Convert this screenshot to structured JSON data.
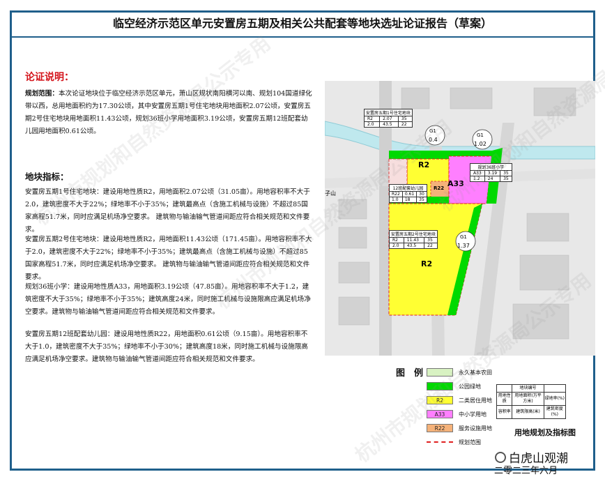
{
  "header": {
    "title": "临空经济示范区单元安置房五期及相关公共配套等地块选址论证报告（草案）"
  },
  "section1": {
    "heading": "论证说明：",
    "lead": "规划范围：",
    "text": "本次论证地块位于临空经济示范区单元，萧山区规状南阳横河以南、规划104国道绿化带以西，总用地面积约为17.30公顷，其中安置房五期1号住宅地块用地面积2.07公顷，安置房五期2号住宅地块用地面积11.43公顷，规划36班小学用地面积3.19公顷，安置房五期12班配套幼儿园用地面积0.61公顷。"
  },
  "section2": {
    "heading": "地块指标：",
    "p1": "安置房五期1号住宅地块：建设用地性质R2，用地面积2.07公顷（31.05亩）。用地容积率不大于2.0，建筑密度不大于22%；绿地率不小于35%；建筑最高点（含施工机械与设施）不超过85国家高程51.7米，同时应满足机场净空要求。 建筑物与输油输气管道间距应符合相关规范和文件要求。",
    "p2": "安置房五期2号住宅地块：建设用地性质R2，用地面积11.43公顷（171.45亩）。用地容积率不大于2.0，建筑密度不大于22%；绿地率不小于35%；建筑最高点（含施工机械与设施）不超过85国家高程51.7米，同时应满足机场净空要求。 建筑物与输油输气管道间距应符合相关规范和文件要求。",
    "p3": "规划36班小学：建设用地性质A33，用地面积3.19公顷（47.85亩）。用地容积率不大于1.2，建筑密度不大于35%；绿地率不小于35%；建筑高度24米，同时施工机械与设施限高应满足机场净空要求。建筑物与输油输气管道间距应符合相关规范和文件要求。",
    "p4": "安置房五期12班配套幼儿园：建设用地性质R22，用地面积0.61公顷（9.15亩）。用地容积率不大于1.0，建筑密度不大于35%；绿地率不小于30%；建筑高度18米，同时施工机械与设施限高应满足机场净空要求。建筑物与输油输气管道间距应符合相关规范和文件要求。"
  },
  "map": {
    "labels": {
      "r2_north": "R2",
      "r2_south": "R2",
      "a33": "A33",
      "r22": "R22",
      "zishan": "子山",
      "g1a": "G1",
      "g1a_val": "0.4",
      "g1b": "G1",
      "g1b_val": "1.02",
      "g1c": "G1",
      "g1c_val": "1.37"
    },
    "table1": {
      "title": "安置房五期1号住宅地块",
      "r1": [
        "R2",
        "2.07",
        "35"
      ],
      "r2": [
        "2.0",
        "43.5",
        "22"
      ]
    },
    "table2": {
      "title": "规划36班小学",
      "r1": [
        "A33",
        "3.19",
        "35"
      ],
      "r2": [
        "1.2",
        "24",
        "35"
      ]
    },
    "table3": {
      "title": "12班配套幼儿园",
      "r1": [
        "R22",
        "0.61",
        "30"
      ],
      "r2": [
        "1.0",
        "18",
        "35"
      ]
    },
    "table4": {
      "title": "安置房五期2号住宅地块",
      "r1": [
        "R2",
        "11.43",
        "35"
      ],
      "r2": [
        "2.0",
        "43.5",
        "22"
      ]
    }
  },
  "legend": {
    "title": "图　例",
    "items": [
      {
        "code": "",
        "label": "永久基本农田",
        "color": "#d8f2c2"
      },
      {
        "code": "",
        "label": "公园绿地",
        "color": "#00d900"
      },
      {
        "code": "R2",
        "label": "二类居住用地",
        "color": "#ffff33"
      },
      {
        "code": "A33",
        "label": "中小学用地",
        "color": "#ff7fff"
      },
      {
        "code": "R22",
        "label": "服务设施用地",
        "color": "#f5b27a"
      },
      {
        "code": "",
        "label": "规划范围",
        "color": "#e02020"
      }
    ],
    "index_table": {
      "header": "地块编号",
      "r1": [
        "用地性质",
        "用地面积(万平方米)",
        "绿地率(%)"
      ],
      "r2": [
        "容积率",
        "建筑限高(米)",
        "建筑密度(%)"
      ]
    },
    "caption": "用地规划及指标图"
  },
  "watermarks": [
    "杭州市规划和自然资源局公示专用",
    "杭州市规划和自然资源局公示专用",
    "杭州市规划和自然资源局公示专用",
    "杭州市规划和自然资源局公示专用"
  ],
  "brand": {
    "name": "白虎山观潮",
    "date": "二零二三年六月"
  }
}
